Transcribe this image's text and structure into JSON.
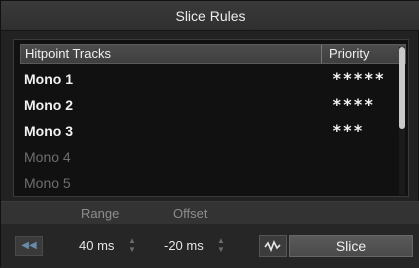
{
  "window": {
    "title": "Slice Rules"
  },
  "table": {
    "columns": [
      "Hitpoint Tracks",
      "Priority"
    ],
    "rows": [
      {
        "name": "Mono 1",
        "priority": "*****",
        "enabled": true
      },
      {
        "name": "Mono 2",
        "priority": "****",
        "enabled": true
      },
      {
        "name": "Mono 3",
        "priority": "***",
        "enabled": true
      },
      {
        "name": "Mono 4",
        "priority": "",
        "enabled": false
      },
      {
        "name": "Mono 5",
        "priority": "",
        "enabled": false
      }
    ]
  },
  "footer": {
    "range_label": "Range",
    "offset_label": "Offset",
    "range_value": "40 ms",
    "offset_value": "-20 ms",
    "slice_label": "Slice"
  },
  "icons": {
    "skip": "skip-to-start-icon",
    "waveform": "waveform-icon",
    "spinner": "spinner-icon"
  },
  "colors": {
    "background": "#222222",
    "panel": "#111111",
    "header": "#444444",
    "text_active": "#f2f2f2",
    "text_dim": "#6e6e6e"
  }
}
